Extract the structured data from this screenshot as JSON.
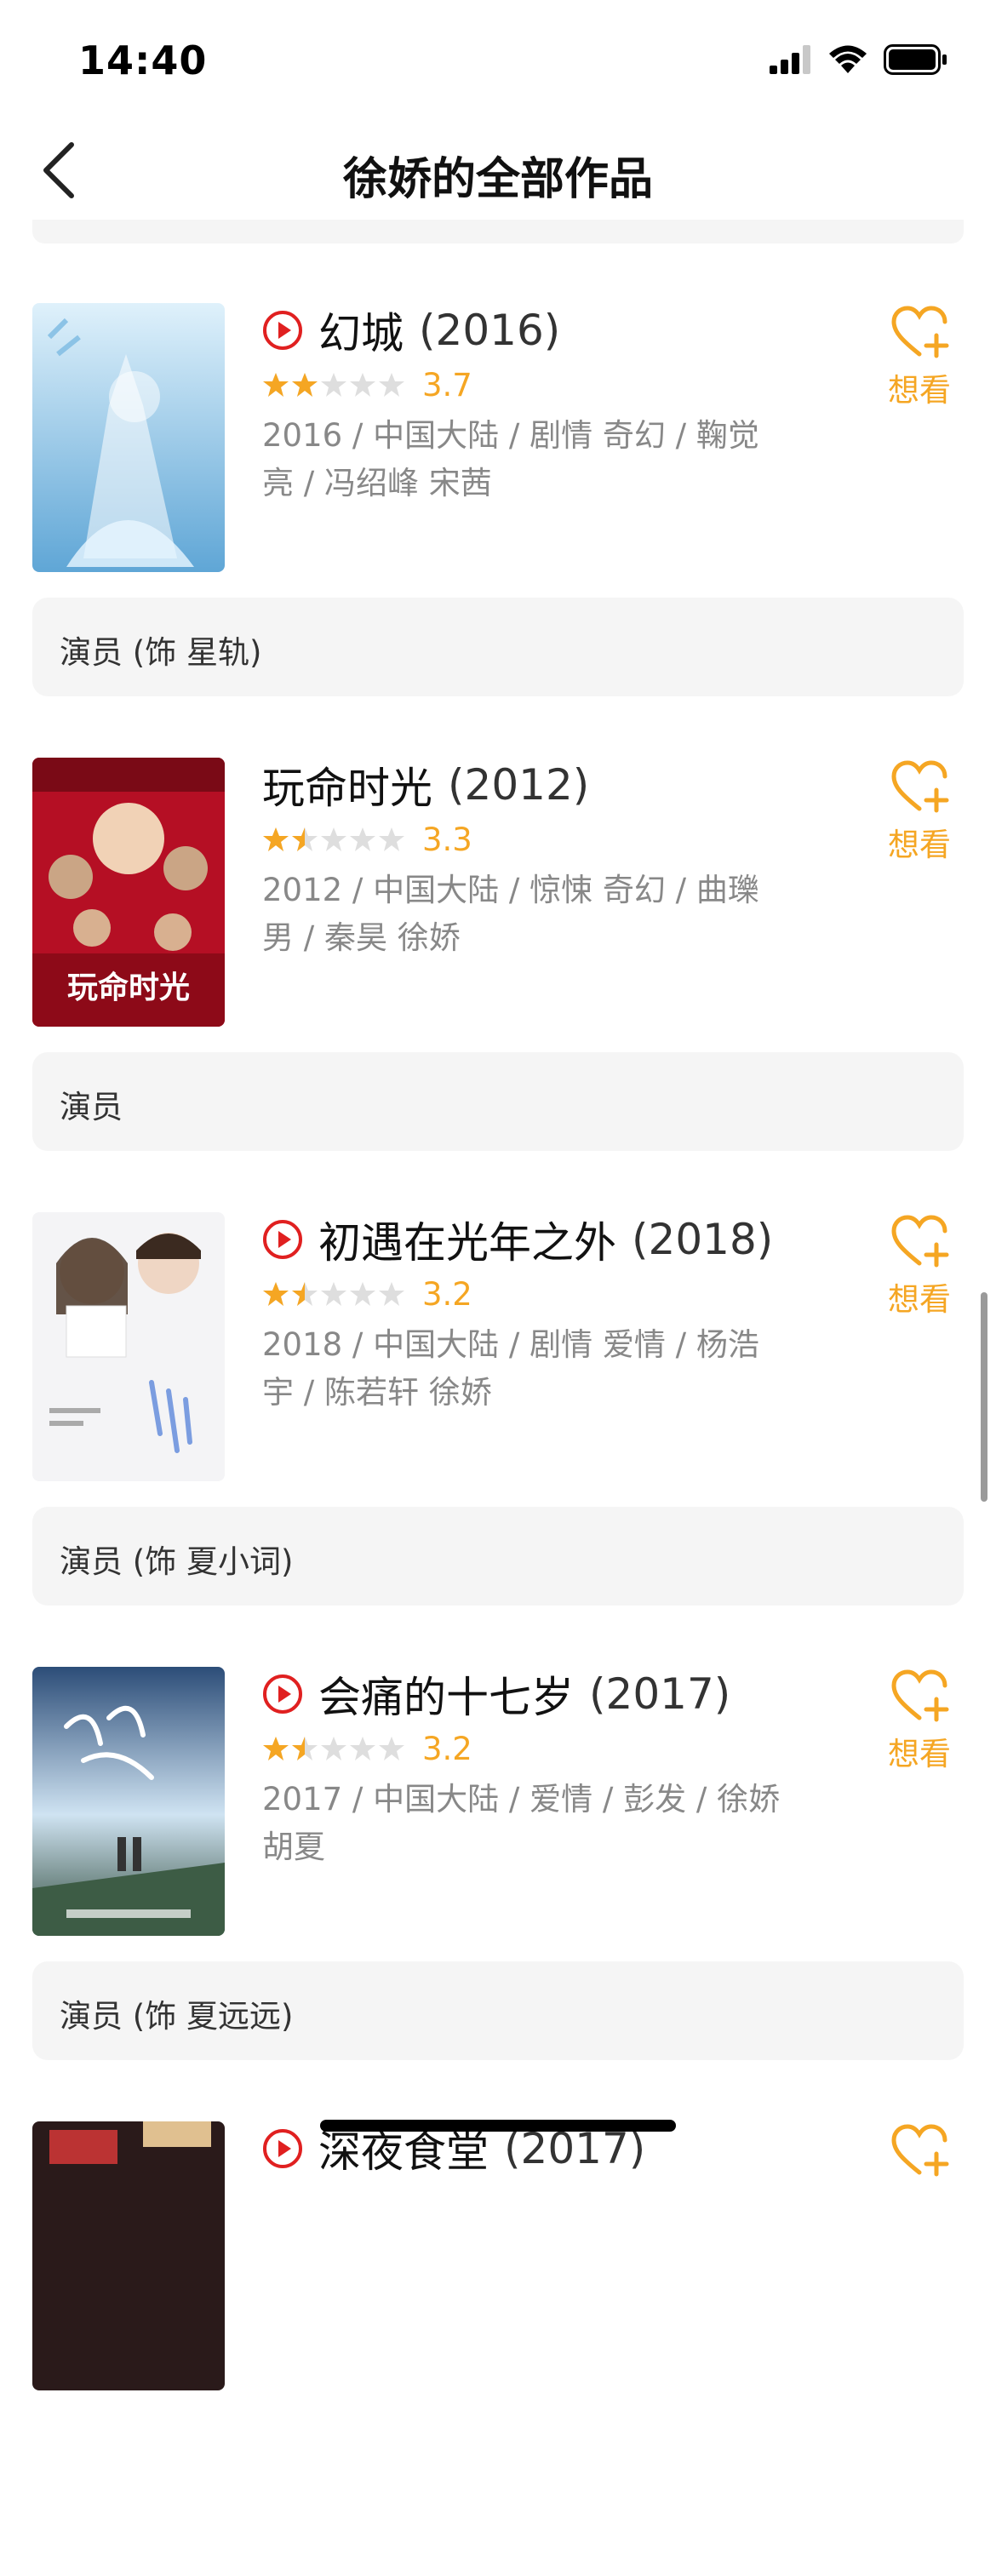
{
  "status_bar": {
    "time": "14:40"
  },
  "nav": {
    "title": "徐娇的全部作品"
  },
  "movies": [
    {
      "title": "幻城",
      "year": "(2016)",
      "has_play": true,
      "rating": 3.7,
      "stars": 2,
      "rating_text": "3.7",
      "meta": "2016 / 中国大陆 / 剧情 奇幻 / 鞠觉亮 / 冯绍峰 宋茜",
      "want_label": "想看",
      "role": "演员 (饰 星轨)",
      "poster_colors": [
        "#bfe3f7",
        "#6fb3e0"
      ]
    },
    {
      "title": "玩命时光",
      "year": "(2012)",
      "has_play": false,
      "rating": 3.3,
      "stars": 1.5,
      "rating_text": "3.3",
      "meta": "2012 / 中国大陆 / 惊悚 奇幻 / 曲瓅男 / 秦昊 徐娇",
      "want_label": "想看",
      "role": "演员",
      "poster_colors": [
        "#c8102e",
        "#3a0a0a"
      ],
      "poster_text": "玩命时光"
    },
    {
      "title": "初遇在光年之外",
      "year": "(2018)",
      "has_play": true,
      "rating": 3.2,
      "stars": 1.5,
      "rating_text": "3.2",
      "meta": "2018 / 中国大陆 / 剧情 爱情 / 杨浩宇 / 陈若轩 徐娇",
      "want_label": "想看",
      "role": "演员 (饰 夏小词)",
      "poster_colors": [
        "#f4f4f6",
        "#d7dce6"
      ]
    },
    {
      "title": "会痛的十七岁",
      "year": "(2017)",
      "has_play": true,
      "rating": 3.2,
      "stars": 1.5,
      "rating_text": "3.2",
      "meta": "2017 / 中国大陆 / 爱情 / 彭发 / 徐娇 胡夏",
      "want_label": "想看",
      "role": "演员 (饰 夏远远)",
      "poster_colors": [
        "#3b5f8a",
        "#cfe3f2"
      ]
    },
    {
      "title": "深夜食堂",
      "year": "(2017)",
      "has_play": true,
      "rating": null,
      "stars": null,
      "rating_text": "",
      "meta": "",
      "want_label": "",
      "role": "",
      "poster_colors": [
        "#2a1a1a",
        "#b33"
      ]
    }
  ],
  "colors": {
    "accent": "#f5a623",
    "play": "#e02020",
    "role_bg": "#f5f5f5"
  }
}
